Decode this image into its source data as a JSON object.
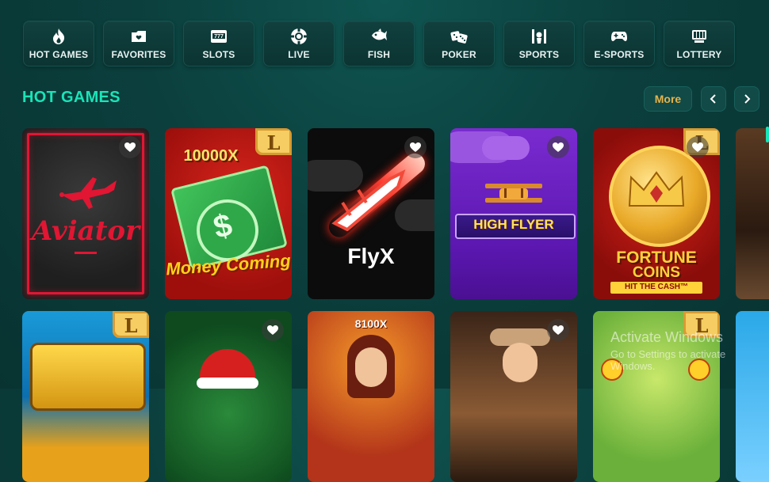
{
  "categories": [
    {
      "label": "HOT GAMES",
      "icon": "flame-icon"
    },
    {
      "label": "FAVORITES",
      "icon": "folder-heart-icon"
    },
    {
      "label": "SLOTS",
      "icon": "slot-machine-icon"
    },
    {
      "label": "LIVE",
      "icon": "casino-chip-icon"
    },
    {
      "label": "FISH",
      "icon": "fish-icon"
    },
    {
      "label": "POKER",
      "icon": "dice-icon"
    },
    {
      "label": "SPORTS",
      "icon": "sports-icon"
    },
    {
      "label": "E-SPORTS",
      "icon": "gamepad-icon"
    },
    {
      "label": "LOTTERY",
      "icon": "lottery-icon"
    }
  ],
  "section": {
    "title": "HOT GAMES",
    "more_label": "More"
  },
  "games_row1": [
    {
      "title": "Aviator"
    },
    {
      "title": "Money Coming",
      "multiplier": "10000X"
    },
    {
      "title": "FlyX"
    },
    {
      "title": "HIGH FLYER"
    },
    {
      "title_line1": "FORTUNE",
      "title_line2": "COINS",
      "subtitle": "HIT THE CASH™"
    }
  ],
  "games_row2": [
    {
      "multiplier": "8100X"
    }
  ],
  "watermark": {
    "line1": "Activate Windows",
    "line2": "Go to Settings to activate Windows."
  },
  "colors": {
    "accent": "#19e4b8",
    "more": "#e7b24a",
    "background": "#0b3f3d"
  }
}
